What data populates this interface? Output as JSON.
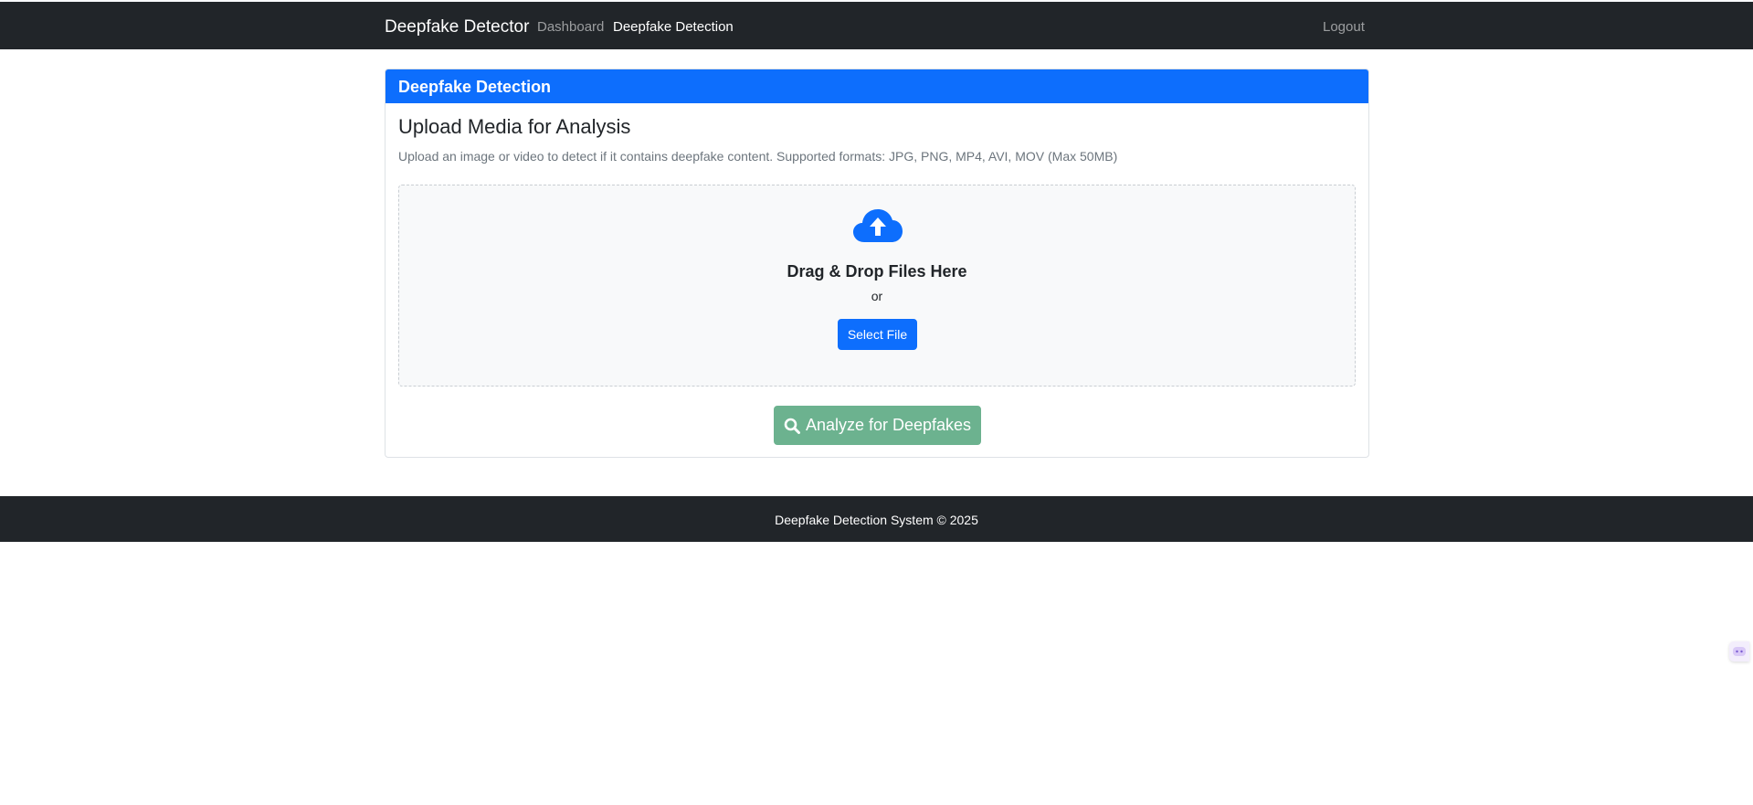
{
  "navbar": {
    "brand": "Deepfake Detector",
    "links": [
      {
        "label": "Dashboard",
        "active": false
      },
      {
        "label": "Deepfake Detection",
        "active": true
      }
    ],
    "logout_label": "Logout"
  },
  "card": {
    "header": "Deepfake Detection",
    "title": "Upload Media for Analysis",
    "description": "Upload an image or video to detect if it contains deepfake content. Supported formats: JPG, PNG, MP4, AVI, MOV (Max 50MB)",
    "dropzone": {
      "icon": "cloud-upload-icon",
      "title": "Drag & Drop Files Here",
      "or_text": "or",
      "select_label": "Select File"
    },
    "analyze": {
      "icon": "search-icon",
      "label": "Analyze for Deepfakes"
    }
  },
  "footer": {
    "text": "Deepfake Detection System © 2025"
  },
  "colors": {
    "navbar_bg": "#212529",
    "primary": "#0d6efd",
    "analyze_button": "#6cb28f",
    "dropzone_bg": "#f8f9fa"
  },
  "floating_widget": {
    "icon": "assistant-icon"
  }
}
